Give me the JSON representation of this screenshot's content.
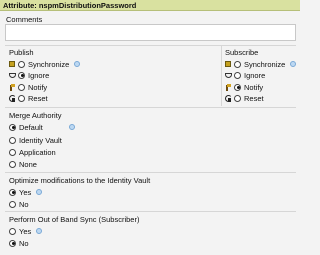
{
  "header": {
    "label": "Attribute:",
    "value": "nspmDistributionPassword"
  },
  "comments": {
    "label": "Comments",
    "value": ""
  },
  "publish": {
    "title": "Publish",
    "options": [
      {
        "icon": "sync-status-icon",
        "label": "Synchronize",
        "selected": false,
        "info": true
      },
      {
        "icon": "ignore-status-icon",
        "label": "Ignore",
        "selected": true,
        "info": false
      },
      {
        "icon": "notify-status-icon",
        "label": "Notify",
        "selected": false,
        "info": false
      },
      {
        "icon": "reset-status-icon",
        "label": "Reset",
        "selected": false,
        "info": false
      }
    ]
  },
  "subscribe": {
    "title": "Subscribe",
    "options": [
      {
        "icon": "sync-status-icon",
        "label": "Synchronize",
        "selected": false,
        "info": true
      },
      {
        "icon": "ignore-status-icon",
        "label": "Ignore",
        "selected": false,
        "info": false
      },
      {
        "icon": "notify-status-icon",
        "label": "Notify",
        "selected": true,
        "info": false
      },
      {
        "icon": "reset-status-icon",
        "label": "Reset",
        "selected": false,
        "info": false
      }
    ]
  },
  "merge_authority": {
    "title": "Merge Authority",
    "options": [
      {
        "label": "Default",
        "selected": true,
        "info": true
      },
      {
        "label": "Identity Vault",
        "selected": false,
        "info": false
      },
      {
        "label": "Application",
        "selected": false,
        "info": false
      },
      {
        "label": "None",
        "selected": false,
        "info": false
      }
    ]
  },
  "optimize": {
    "title": "Optimize modifications to the Identity Vault",
    "options": [
      {
        "label": "Yes",
        "selected": true,
        "info": true
      },
      {
        "label": "No",
        "selected": false,
        "info": false
      }
    ]
  },
  "out_of_band": {
    "title": "Perform Out of Band Sync (Subscriber)",
    "options": [
      {
        "label": "Yes",
        "selected": false,
        "info": true
      },
      {
        "label": "No",
        "selected": true,
        "info": false
      }
    ]
  },
  "colors": {
    "header_bg": "#d9e1a0",
    "info_icon": "#bcd8f2"
  }
}
